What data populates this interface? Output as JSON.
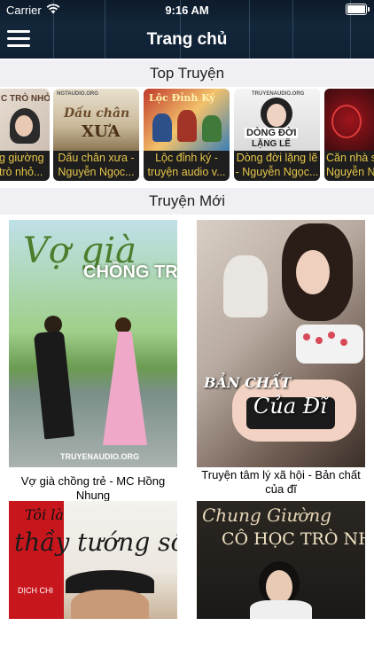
{
  "status_bar": {
    "carrier": "Carrier",
    "time": "9:16 AM"
  },
  "header": {
    "title": "Trang chủ",
    "menu_icon": "hamburger-menu-icon"
  },
  "top_section": {
    "title": "Top Truyện",
    "items": [
      {
        "line1": "g giường",
        "line2": "trò nhỏ...",
        "art_text": "C TRÒ NHỎ"
      },
      {
        "line1": "Dấu chân xưa -",
        "line2": "Nguyễn Ngọc...",
        "art_text": "XƯA",
        "art_text2": "Dấu chân",
        "art_text3": "NGTAUDIO.ORG"
      },
      {
        "line1": "Lộc đỉnh ký -",
        "line2": "truyện audio v...",
        "art_text": "Lộc Đỉnh Ký"
      },
      {
        "line1": "Dòng đời lặng lẽ",
        "line2": "- Nguyễn Ngọc...",
        "art_text": "DÒNG ĐỜI",
        "art_text2": "LẶNG LẼ",
        "art_text3": "TRUYENAUDIO.ORG"
      },
      {
        "line1": "Căn nhà s",
        "line2": "Nguyễn N",
        "art_text": ""
      }
    ]
  },
  "new_section": {
    "title": "Truyện Mới",
    "items": [
      {
        "label": "Vợ già chồng trẻ - MC Hồng Nhung",
        "art_text": "Vợ già",
        "art_text2": "CHỒNG TRẺ",
        "art_text3": "TRUYENAUDIO.ORG"
      },
      {
        "label": "Truyện tâm lý xã hội - Bản chất của đĩ",
        "art_text": "BẢN CHẤT",
        "art_text2": "Của Đĩ"
      },
      {
        "label": "",
        "art_text": "Tôi là",
        "art_text2": "thầy tướng số",
        "art_text3": "DỊCH CHI"
      },
      {
        "label": "",
        "art_text": "Chung Giường",
        "art_text2": "CÔ HỌC TRÒ NHỎ"
      }
    ]
  }
}
